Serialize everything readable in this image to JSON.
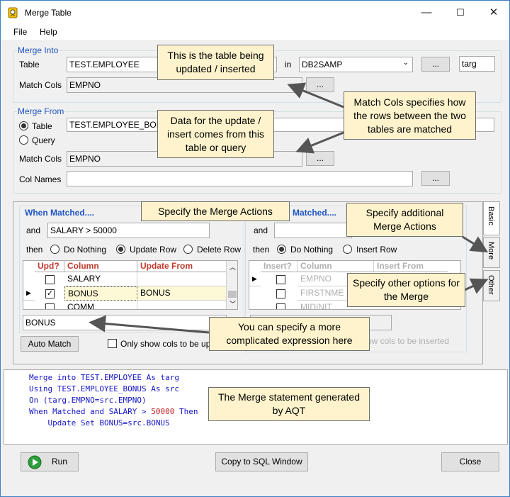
{
  "window": {
    "title": "Merge Table",
    "min": "—",
    "max": "☐",
    "close": "✕"
  },
  "menu": {
    "file": "File",
    "help": "Help"
  },
  "merge_into": {
    "label": "Merge Into",
    "table_label": "Table",
    "table_value": "TEST.EMPLOYEE",
    "in_label": "in",
    "db_value": "DB2SAMP",
    "browse": "...",
    "alias": "targ",
    "match_cols_label": "Match Cols",
    "match_cols_value": "EMPNO",
    "match_browse": "..."
  },
  "merge_from": {
    "label": "Merge From",
    "table_radio": "Table",
    "query_radio": "Query",
    "table_value": "TEST.EMPLOYEE_BONUS",
    "match_cols_label": "Match Cols",
    "match_cols_value": "EMPNO",
    "match_browse": "...",
    "col_names_label": "Col Names",
    "col_names_value": "",
    "col_browse": "..."
  },
  "when_matched": {
    "label": "When Matched....",
    "and_label": "and",
    "condition": "SALARY > 50000",
    "then_label": "then",
    "opt_nothing": "Do Nothing",
    "opt_update": "Update Row",
    "opt_delete": "Delete Row",
    "headers": [
      "Upd?",
      "Column",
      "Update From"
    ],
    "rows": [
      {
        "checked": false,
        "column": "SALARY",
        "from": ""
      },
      {
        "checked": true,
        "column": "BONUS",
        "from": "BONUS"
      },
      {
        "checked": false,
        "column": "COMM",
        "from": ""
      }
    ],
    "expression": "BONUS"
  },
  "when_not_matched": {
    "label": "Matched....",
    "and_label": "and",
    "then_label": "then",
    "opt_nothing": "Do Nothing",
    "opt_insert": "Insert Row",
    "headers": [
      "Insert?",
      "Column",
      "Insert From"
    ],
    "rows": [
      {
        "column": "EMPNO"
      },
      {
        "column": "FIRSTNME"
      },
      {
        "column": "MIDINIT"
      }
    ],
    "only_show_insert": "ow cols to be inserted"
  },
  "auto_match": "Auto Match",
  "only_show_update": "Only show cols to be up",
  "tabs": [
    "Basic",
    "More",
    "Other"
  ],
  "sql_lines": [
    [
      {
        "t": "Merge into ",
        "k": "kw"
      },
      {
        "t": "TEST.EMPLOYEE ",
        "k": "str"
      },
      {
        "t": "As ",
        "k": "kw"
      },
      {
        "t": "targ",
        "k": "str"
      }
    ],
    [
      {
        "t": "Using ",
        "k": "kw"
      },
      {
        "t": "TEST.EMPLOYEE_BONUS ",
        "k": "str"
      },
      {
        "t": "As ",
        "k": "kw"
      },
      {
        "t": "src",
        "k": "str"
      }
    ],
    [
      {
        "t": "On ",
        "k": "kw"
      },
      {
        "t": "(targ.EMPNO=src.EMPNO)",
        "k": "str"
      }
    ],
    [
      {
        "t": "When ",
        "k": "kw"
      },
      {
        "t": "Matched ",
        "k": "str"
      },
      {
        "t": "and ",
        "k": "kw"
      },
      {
        "t": "SALARY > ",
        "k": "str"
      },
      {
        "t": "50000 ",
        "k": "num"
      },
      {
        "t": "Then",
        "k": "kw"
      }
    ],
    [
      {
        "t": "    Update Set ",
        "k": "kw"
      },
      {
        "t": "BONUS=src.BONUS",
        "k": "str"
      }
    ]
  ],
  "buttons": {
    "run": "Run",
    "copy": "Copy to SQL Window",
    "close": "Close"
  },
  "callouts": {
    "c1": "This is the table being updated / inserted",
    "c2": "Match Cols specifies how the rows between the two tables are matched",
    "c3": "Data for the update / insert comes from this table or query",
    "c4": "Specify the Merge Actions",
    "c5": "Specify additional Merge Actions",
    "c6": "Specify other options for the Merge",
    "c7": "You can specify a more complicated expression here",
    "c8": "The Merge statement generated by AQT"
  },
  "colors": {
    "accent": "#1f55c4",
    "callout_bg": "#fef3cc",
    "run_icon": "#2e9e3a"
  }
}
